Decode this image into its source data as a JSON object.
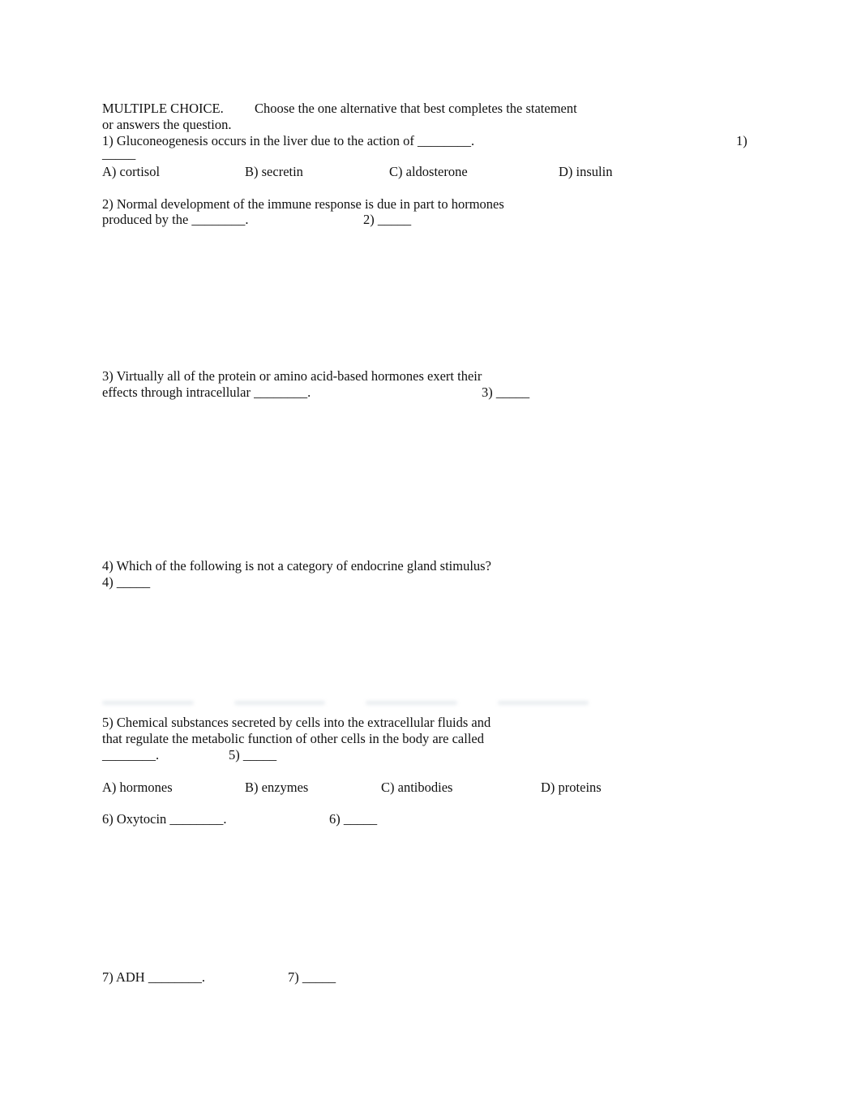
{
  "header": {
    "section": "MULTIPLE CHOICE.",
    "instruction_1": "Choose the one alternative that best completes the statement",
    "instruction_2": "or answers the question."
  },
  "questions": [
    {
      "lines": [
        "1) Gluconeogenesis occurs in the liver due to the action of ________."
      ],
      "answer_label": "1)",
      "answer_blank": "_____",
      "options": [
        "A) cortisol",
        "B) secretin",
        "C) aldosterone",
        "D) insulin"
      ]
    },
    {
      "lines": [
        "2) Normal development of the immune response is due in part to hormones",
        "produced by the ________."
      ],
      "answer_label": "2) _____"
    },
    {
      "lines": [
        "3) Virtually all of the protein or amino acid-based hormones exert their",
        "effects through intracellular ________."
      ],
      "answer_label": "3) _____"
    },
    {
      "lines": [
        "4) Which of the following is not a category of endocrine gland stimulus?"
      ],
      "answer_label": "4) _____"
    },
    {
      "lines": [
        "5) Chemical substances secreted by cells into the extracellular fluids and",
        "that regulate the metabolic function of other cells in the body are called",
        "________."
      ],
      "answer_label": "5) _____",
      "options": [
        "A) hormones",
        "B) enzymes",
        "C) antibodies",
        "D) proteins"
      ]
    },
    {
      "lines": [
        "6) Oxytocin ________."
      ],
      "answer_label": "6) _____"
    },
    {
      "lines": [
        "7) ADH ________."
      ],
      "answer_label": "7) _____"
    }
  ]
}
